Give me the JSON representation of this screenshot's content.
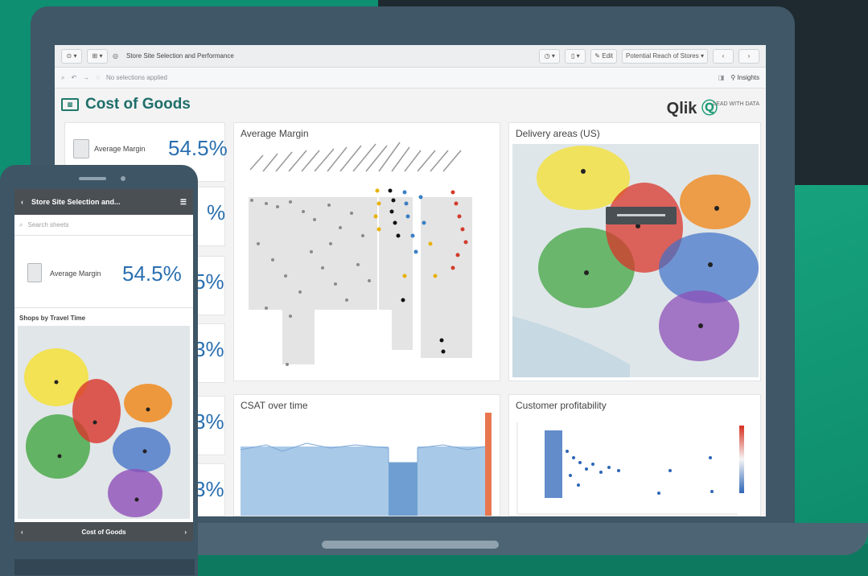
{
  "toolbar": {
    "sheet_title": "Store Site Selection and Performance",
    "selections_placeholder": "No selections applied",
    "edit_label": "Edit",
    "bookmark_label": "Potential Reach of Stores",
    "insights_label": "Insights"
  },
  "app": {
    "title": "Cost of Goods",
    "logo_text": "Qlik",
    "tagline": "LEAD WITH DATA"
  },
  "kpis": [
    {
      "label": "Average Margin",
      "value": "54.5%"
    },
    {
      "label": "",
      "value": "%"
    },
    {
      "label": "",
      "value": "5%"
    },
    {
      "label": "",
      "value": "3%"
    },
    {
      "label": "",
      "value": "3%"
    },
    {
      "label": "",
      "value": "3%"
    }
  ],
  "panels": {
    "average_margin": "Average Margin",
    "delivery_areas": "Delivery areas (US)",
    "csat": "CSAT over time",
    "profitability": "Customer profitability"
  },
  "map_tooltip": "",
  "phone": {
    "header_title": "Store Site Selection and...",
    "search_placeholder": "Search sheets",
    "kpi_label": "Average Margin",
    "kpi_value": "54.5%",
    "section_title": "Shops by Travel Time",
    "footer_label": "Cost of Goods"
  },
  "colors": {
    "accent_teal": "#1f6e6a",
    "kpi_blue": "#2a6fb0",
    "qlik_green": "#1b9b74"
  }
}
